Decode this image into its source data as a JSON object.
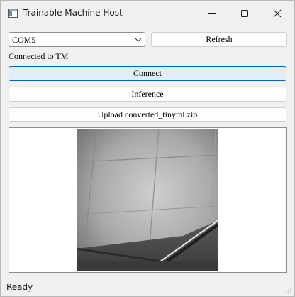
{
  "window": {
    "title": "Trainable Machine Host",
    "icon": "app-window-icon",
    "controls": [
      "minimize-icon",
      "maximize-icon",
      "close-icon"
    ]
  },
  "port_select": {
    "selected": "COM5",
    "icon": "chevron-down-icon"
  },
  "buttons": {
    "refresh": "Refresh",
    "connect": "Connect",
    "inference": "Inference",
    "upload": "Upload converted_tinyml.zip"
  },
  "connection_status": "Connected to TM",
  "status_bar": {
    "text": "Ready",
    "icon": "size-grip-icon"
  },
  "colors": {
    "accent": "#0067c0",
    "connect_bg": "#e0eef9",
    "window_bg": "#f0f0f0"
  }
}
